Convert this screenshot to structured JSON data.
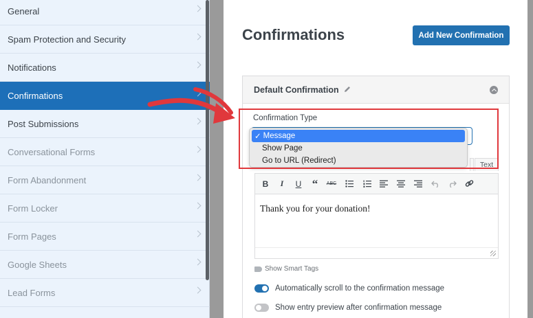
{
  "sidebar": {
    "items": [
      {
        "label": "General",
        "state": "normal"
      },
      {
        "label": "Spam Protection and Security",
        "state": "normal"
      },
      {
        "label": "Notifications",
        "state": "normal"
      },
      {
        "label": "Confirmations",
        "state": "active"
      },
      {
        "label": "Post Submissions",
        "state": "normal"
      },
      {
        "label": "Conversational Forms",
        "state": "dim"
      },
      {
        "label": "Form Abandonment",
        "state": "dim"
      },
      {
        "label": "Form Locker",
        "state": "dim"
      },
      {
        "label": "Form Pages",
        "state": "dim"
      },
      {
        "label": "Google Sheets",
        "state": "dim"
      },
      {
        "label": "Lead Forms",
        "state": "dim"
      }
    ]
  },
  "main": {
    "title": "Confirmations",
    "add_button_label": "Add New Confirmation"
  },
  "confirmation": {
    "title": "Default Confirmation",
    "type_label": "Confirmation Type",
    "dropdown": {
      "options": [
        "Message",
        "Show Page",
        "Go to URL (Redirect)"
      ],
      "selected": "Message"
    },
    "editor": {
      "text_tab_label": "Text",
      "content": "Thank you for your donation!",
      "toolbar": [
        "bold",
        "italic",
        "underline",
        "blockquote",
        "strikethrough",
        "bullet-list",
        "numbered-list",
        "align-left",
        "align-center",
        "align-right",
        "undo",
        "redo",
        "link"
      ]
    },
    "smart_tags_label": "Show Smart Tags",
    "toggles": [
      {
        "label": "Automatically scroll to the confirmation message",
        "on": true
      },
      {
        "label": "Show entry preview after confirmation message",
        "on": false
      }
    ]
  },
  "colors": {
    "accent": "#2271b1",
    "sidebar_active": "#1d6fb8",
    "sidebar_bg": "#ebf3fc",
    "annotation": "#e0383c",
    "dropdown_highlight": "#3a82f6"
  }
}
